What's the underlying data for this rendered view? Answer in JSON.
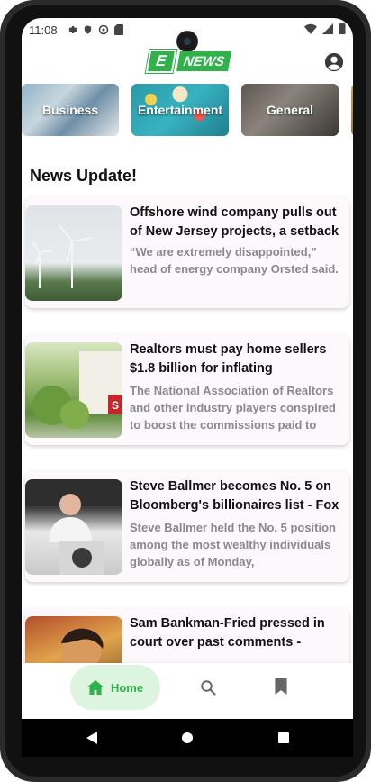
{
  "status_bar": {
    "time": "11:08",
    "left_icons": [
      "gear-icon",
      "shield-icon",
      "sync-icon",
      "sd-card-icon"
    ],
    "right_icons": [
      "wifi-icon",
      "signal-icon",
      "battery-icon"
    ]
  },
  "app": {
    "logo_letter": "E",
    "logo_text": "NEWS"
  },
  "categories": [
    {
      "label": "Business"
    },
    {
      "label": "Entertainment"
    },
    {
      "label": "General"
    }
  ],
  "section_title": "News Update!",
  "articles": [
    {
      "title": "Offshore wind company pulls out of New Jersey projects, a setback",
      "description": "“We are extremely disappointed,” head of energy company Orsted said."
    },
    {
      "title": "Realtors must pay home sellers $1.8 billion for inflating",
      "description": "The National Association of Realtors and other industry players conspired to boost the commissions paid to"
    },
    {
      "title": "Steve Ballmer becomes No. 5 on Bloomberg's billionaires list - Fox",
      "description": "Steve Ballmer held the No. 5 position among the most wealthy individuals globally as of Monday,"
    },
    {
      "title": "Sam Bankman-Fried pressed in court over past comments -",
      "description": ""
    }
  ],
  "bottom_nav": {
    "home_label": "Home"
  },
  "colors": {
    "accent": "#2eb34a",
    "accent_light": "#ddf5df"
  }
}
